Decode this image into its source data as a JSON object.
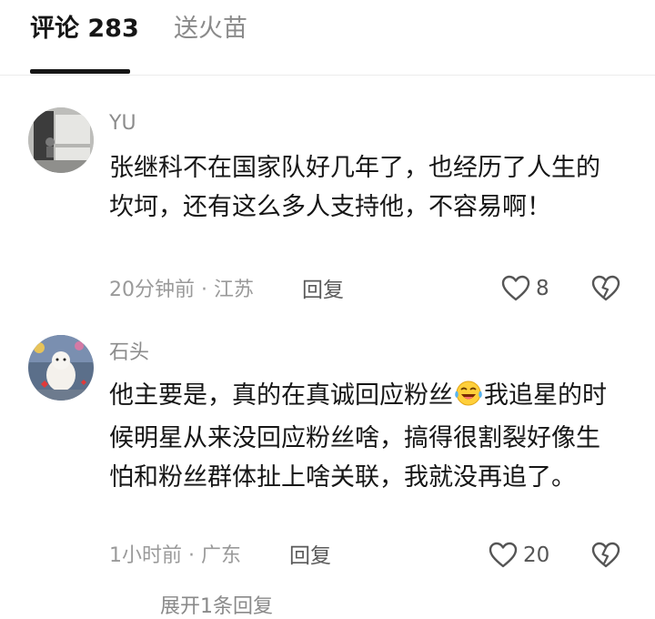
{
  "tabs": {
    "comments": "评论 283",
    "fire": "送火苗"
  },
  "comments": [
    {
      "username": "YU",
      "content": "张继科不在国家队好几年了，也经历了人生的坎坷，还有这么多人支持他，不容易啊！",
      "meta": "20分钟前 · 江苏",
      "reply_label": "回复",
      "likes": "8"
    },
    {
      "username": "石头",
      "content_before_emoji": "他主要是，真的在真诚回应粉丝",
      "emoji": "laughing-tears-emoji",
      "content_after_emoji": "我追星的时候明星从来没回应粉丝啥，搞得很割裂好像生怕和粉丝群体扯上啥关联，我就没再追了。",
      "meta": "1小时前 · 广东",
      "reply_label": "回复",
      "likes": "20"
    }
  ],
  "footer": {
    "expand_label": "展开1条回复"
  },
  "colors": {
    "text": "#161616",
    "muted": "#9a9a9a",
    "accent": "#161616"
  }
}
